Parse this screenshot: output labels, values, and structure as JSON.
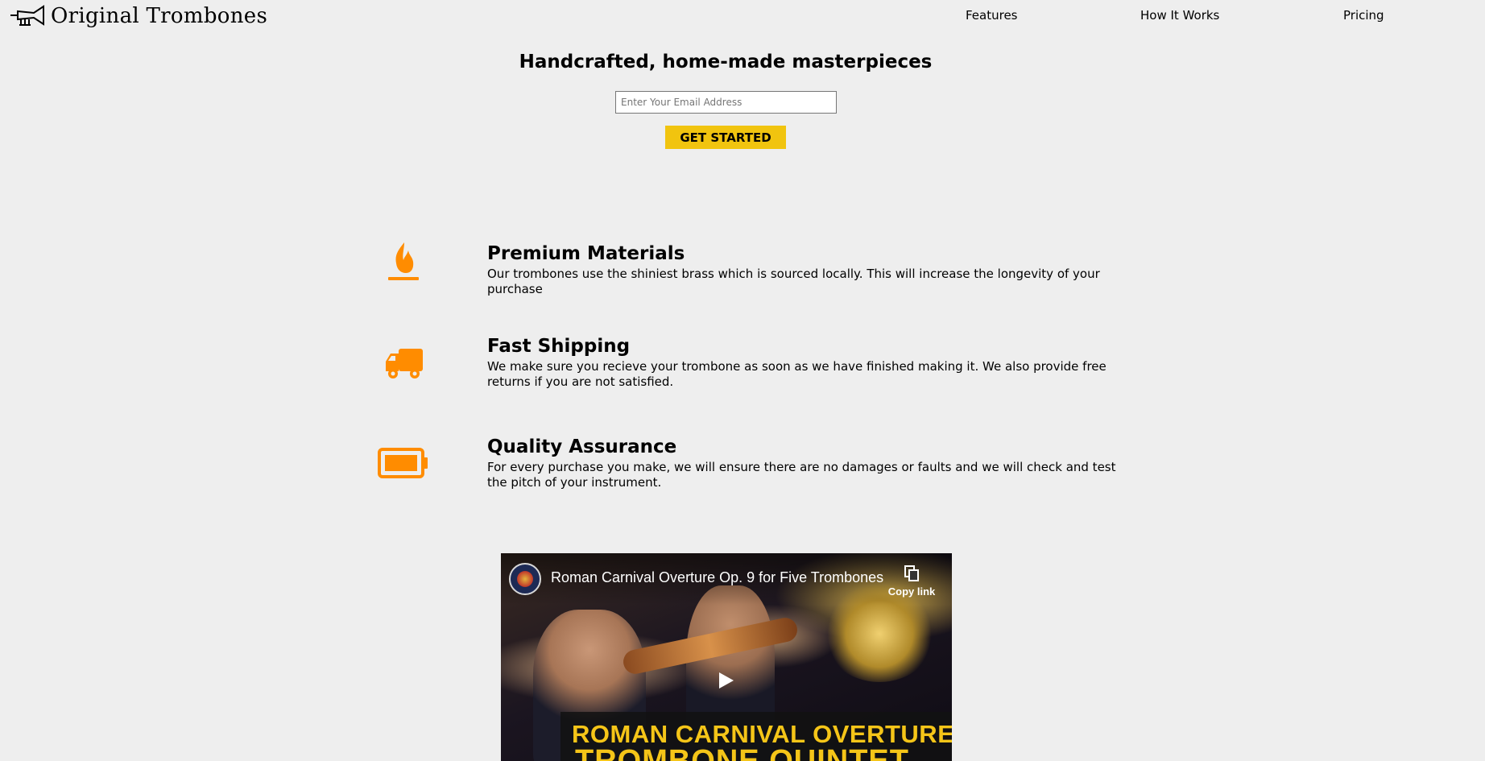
{
  "header": {
    "logo_text": "Original Trombones",
    "logo_icon": "trumpet-icon",
    "nav": {
      "features": "Features",
      "how_it_works": "How It Works",
      "pricing": "Pricing"
    }
  },
  "hero": {
    "title": "Handcrafted, home-made masterpieces",
    "email_placeholder": "Enter Your Email Address",
    "email_value": "",
    "cta_label": "GET STARTED"
  },
  "features": [
    {
      "icon": "fire-icon",
      "title": "Premium Materials",
      "description": "Our trombones use the shiniest brass which is sourced locally. This will increase the longevity of your purchase"
    },
    {
      "icon": "truck-icon",
      "title": "Fast Shipping",
      "description": "We make sure you recieve your trombone as soon as we have finished making it. We also provide free returns if you are not satisfied."
    },
    {
      "icon": "battery-full-icon",
      "title": "Quality Assurance",
      "description": "For every purchase you make, we will ensure there are no damages or faults and we will check and test the pitch of your instrument."
    }
  ],
  "video": {
    "title": "Roman Carnival Overture Op. 9 for Five Trombones",
    "copy_link_label": "Copy link",
    "banner_line1": "ROMAN CARNIVAL OVERTURE",
    "banner_line2": "TROMBONE QUINTET"
  },
  "colors": {
    "background": "#eeeeee",
    "accent_button": "#f1c40f",
    "icon_orange": "#ff8c00",
    "banner_text": "#f5c518"
  }
}
